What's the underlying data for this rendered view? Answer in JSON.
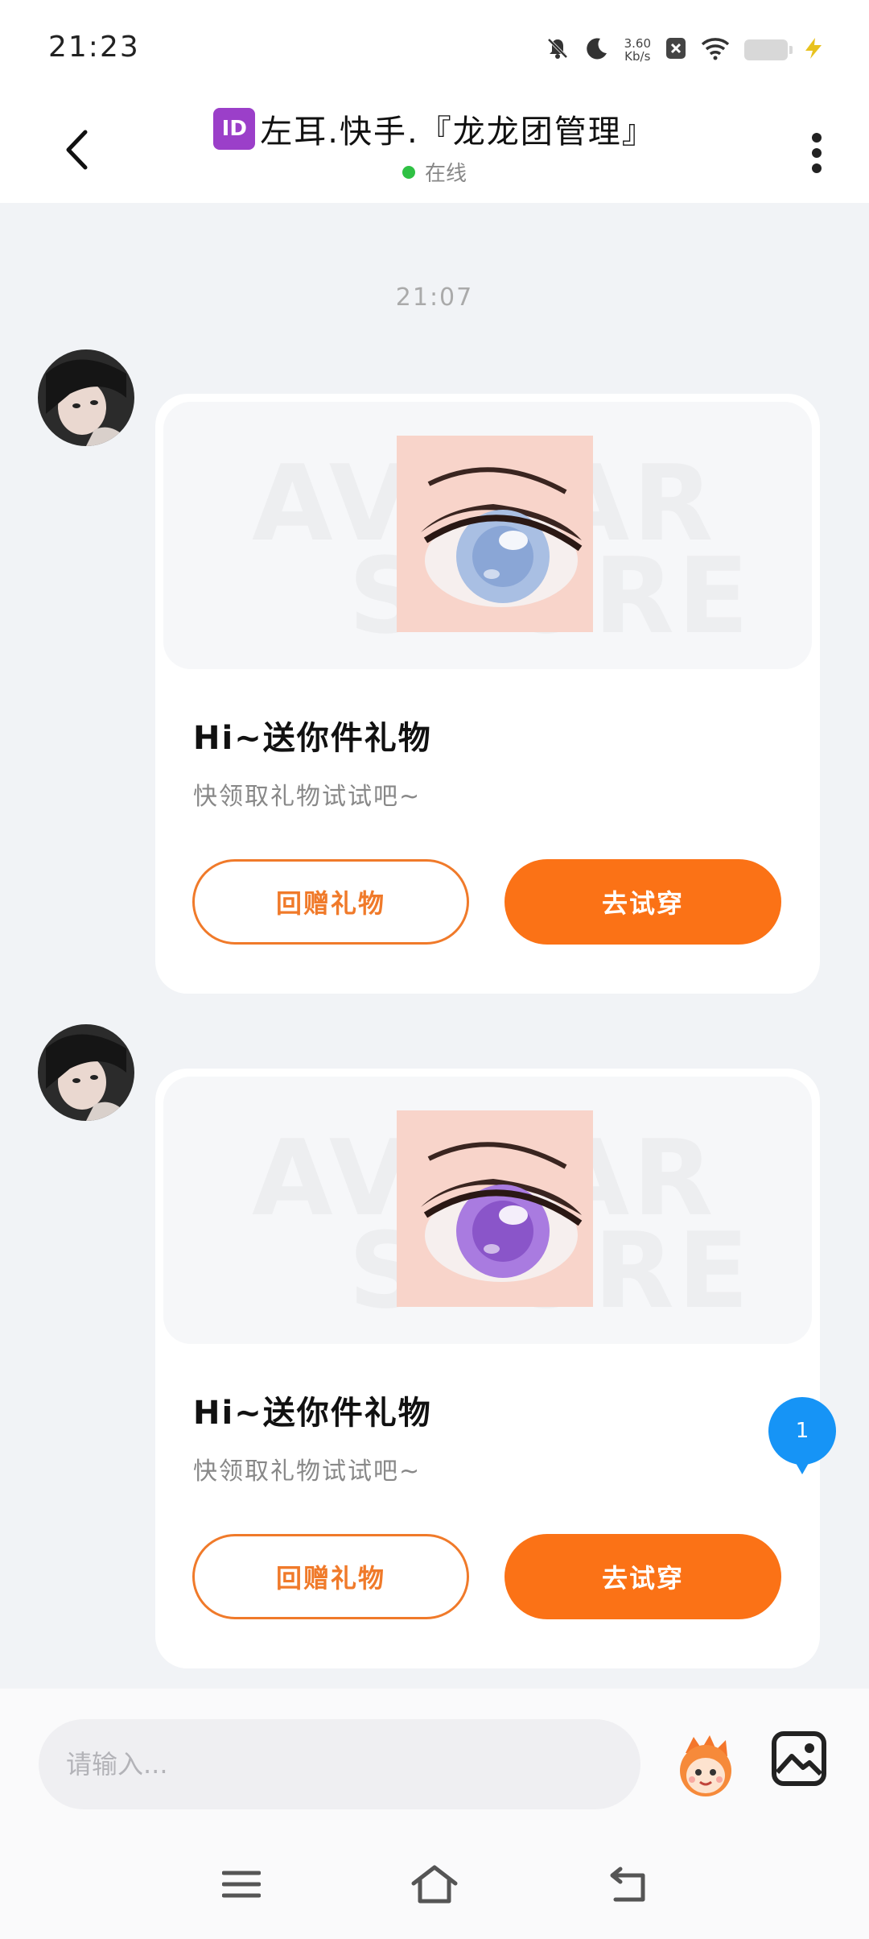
{
  "status_bar": {
    "time": "21:23",
    "net_speed_value": "3.60",
    "net_speed_unit": "Kb/s"
  },
  "header": {
    "id_badge": "ID",
    "title": "左耳.快手.『龙龙团管理』",
    "status": "在线"
  },
  "chat": {
    "timestamp": "21:07",
    "messages": [
      {
        "title": "Hi~送你件礼物",
        "subtitle": "快领取礼物试试吧~",
        "return_gift_label": "回赠礼物",
        "try_on_label": "去试穿",
        "watermark_top": "AVATAR",
        "watermark_bottom": "STORE",
        "iris_color": "#a9bfe3"
      },
      {
        "title": "Hi~送你件礼物",
        "subtitle": "快领取礼物试试吧~",
        "return_gift_label": "回赠礼物",
        "try_on_label": "去试穿",
        "watermark_top": "AVATAR",
        "watermark_bottom": "STORE",
        "iris_color": "#a97be0"
      }
    ],
    "unread_badge": "1"
  },
  "input_bar": {
    "placeholder": "请输入..."
  },
  "colors": {
    "accent": "#fb7216",
    "online": "#2fc144",
    "badge": "#1694f6"
  },
  "icons": {
    "back": "back-arrow-icon",
    "more": "more-vertical-icon",
    "emoji": "mascot-emoji-icon",
    "image": "image-icon",
    "nav_menu": "menu-icon",
    "nav_home": "home-icon",
    "nav_back": "back-icon"
  }
}
